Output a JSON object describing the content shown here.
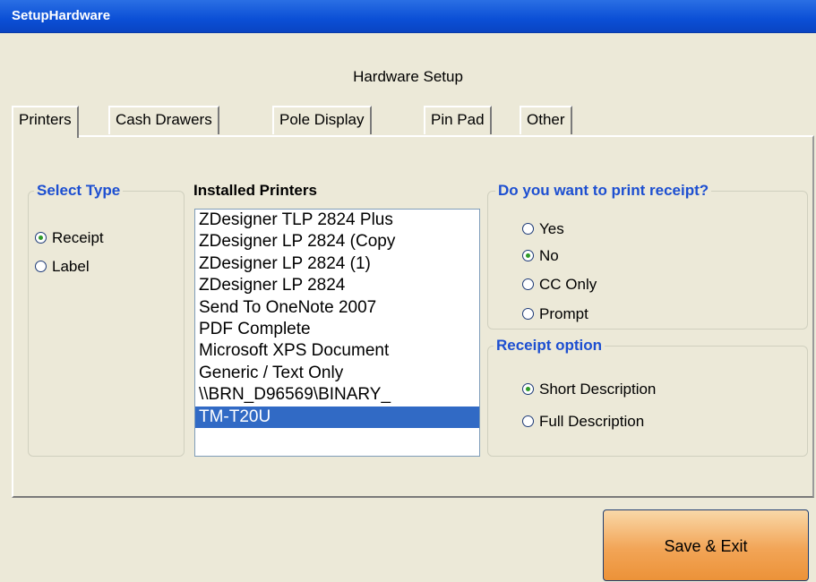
{
  "window": {
    "title": "SetupHardware"
  },
  "heading": "Hardware Setup",
  "tabs": [
    {
      "label": "Printers",
      "active": true
    },
    {
      "label": "Cash Drawers",
      "active": false
    },
    {
      "label": "Pole Display",
      "active": false
    },
    {
      "label": "Pin Pad",
      "active": false
    },
    {
      "label": "Other",
      "active": false
    }
  ],
  "select_type": {
    "legend": "Select Type",
    "options": [
      {
        "label": "Receipt",
        "checked": true
      },
      {
        "label": "Label",
        "checked": false
      }
    ]
  },
  "installed_printers": {
    "legend": "Installed Printers",
    "items": [
      "ZDesigner TLP 2824 Plus",
      "ZDesigner LP 2824 (Copy",
      "ZDesigner LP 2824 (1)",
      "ZDesigner LP 2824",
      "Send To OneNote 2007",
      "PDF Complete",
      "Microsoft XPS Document",
      "Generic / Text Only",
      "\\\\BRN_D96569\\BINARY_",
      "TM-T20U"
    ],
    "selected": "TM-T20U"
  },
  "print_receipt": {
    "legend": "Do you want to print receipt?",
    "options": [
      {
        "label": "Yes",
        "checked": false
      },
      {
        "label": "No",
        "checked": true
      },
      {
        "label": "CC Only",
        "checked": false
      },
      {
        "label": "Prompt",
        "checked": false
      }
    ]
  },
  "receipt_option": {
    "legend": "Receipt option",
    "options": [
      {
        "label": "Short Description",
        "checked": true
      },
      {
        "label": "Full Description",
        "checked": false
      }
    ]
  },
  "buttons": {
    "save_exit": "Save & Exit"
  },
  "colors": {
    "titlebar": "#0b4fd6",
    "group_legend": "#1d4fd1",
    "selection": "#316ac5",
    "save_button": "#f2a557",
    "radio_dot": "#2e9a28"
  }
}
